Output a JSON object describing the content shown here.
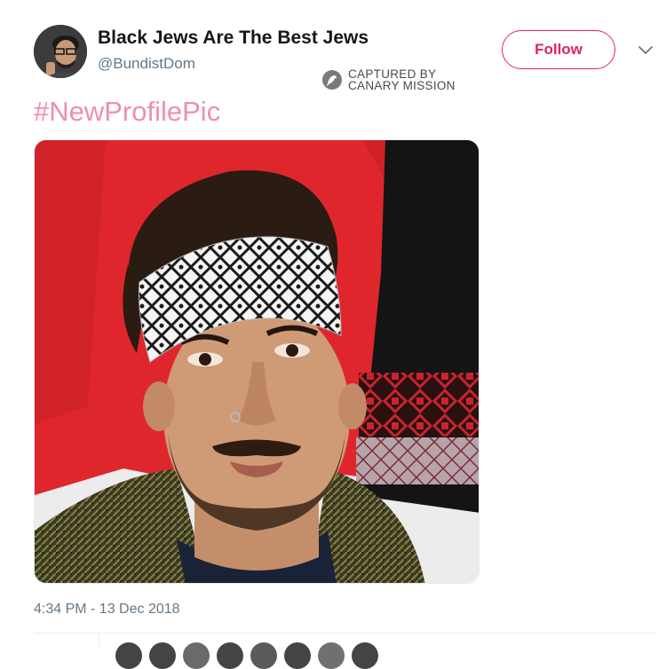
{
  "tweet": {
    "display_name": "Black Jews Are The Best Jews",
    "handle": "@BundistDom",
    "follow_label": "Follow",
    "hashtag": "#NewProfilePic",
    "timestamp": "4:34 PM - 13 Dec 2018"
  },
  "watermark": {
    "line1": "CAPTURED BY",
    "line2": "CANARY MISSION"
  },
  "colors": {
    "accent": "#e0245e",
    "hashtag": "#f08db0",
    "secondary_text": "#657786",
    "primary_text": "#14171a"
  },
  "icons": {
    "caret": "chevron-down-icon",
    "watermark": "canary-mission-logo"
  },
  "liker_avatar_count": 8
}
